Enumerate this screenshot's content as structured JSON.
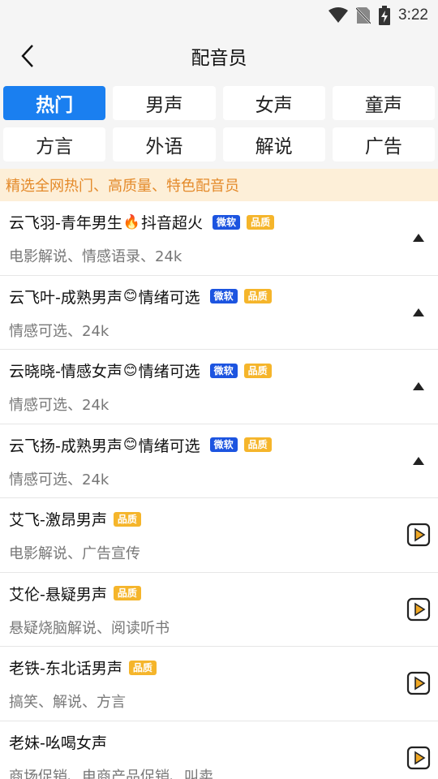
{
  "status": {
    "time": "3:22"
  },
  "header": {
    "title": "配音员"
  },
  "tabs": [
    {
      "label": "热门",
      "active": true
    },
    {
      "label": "男声"
    },
    {
      "label": "女声"
    },
    {
      "label": "童声"
    },
    {
      "label": "方言"
    },
    {
      "label": "外语"
    },
    {
      "label": "解说"
    },
    {
      "label": "广告"
    }
  ],
  "banner": {
    "text": "精选全网热门、高质量、特色配音员"
  },
  "badges": {
    "microsoft": "微软",
    "quality": "品质"
  },
  "voices": [
    {
      "name_pre": "云飞羽-青年男生",
      "emoji": "🔥",
      "name_post": "抖音超火",
      "desc": "电影解说、情感语录、24k",
      "ms": true,
      "pz": true,
      "action": "collapse"
    },
    {
      "name_pre": "云飞叶-成熟男声",
      "emoji": "😊",
      "name_post": "情绪可选",
      "desc": "情感可选、24k",
      "ms": true,
      "pz": true,
      "action": "collapse"
    },
    {
      "name_pre": "云晓晓-情感女声",
      "emoji": "😊",
      "name_post": "情绪可选",
      "desc": "情感可选、24k",
      "ms": true,
      "pz": true,
      "action": "collapse"
    },
    {
      "name_pre": "云飞扬-成熟男声",
      "emoji": "😊",
      "name_post": "情绪可选",
      "desc": "情感可选、24k",
      "ms": true,
      "pz": true,
      "action": "collapse"
    },
    {
      "name_pre": "艾飞-激昂男声",
      "desc": "电影解说、广告宣传",
      "pz": true,
      "action": "play"
    },
    {
      "name_pre": "艾伦-悬疑男声",
      "desc": "悬疑烧脑解说、阅读听书",
      "pz": true,
      "action": "play"
    },
    {
      "name_pre": "老铁-东北话男声",
      "desc": "搞笑、解说、方言",
      "pz": true,
      "action": "play"
    },
    {
      "name_pre": "老妹-吆喝女声",
      "desc": "商场促销、电商产品促销、叫卖",
      "action": "play"
    }
  ]
}
